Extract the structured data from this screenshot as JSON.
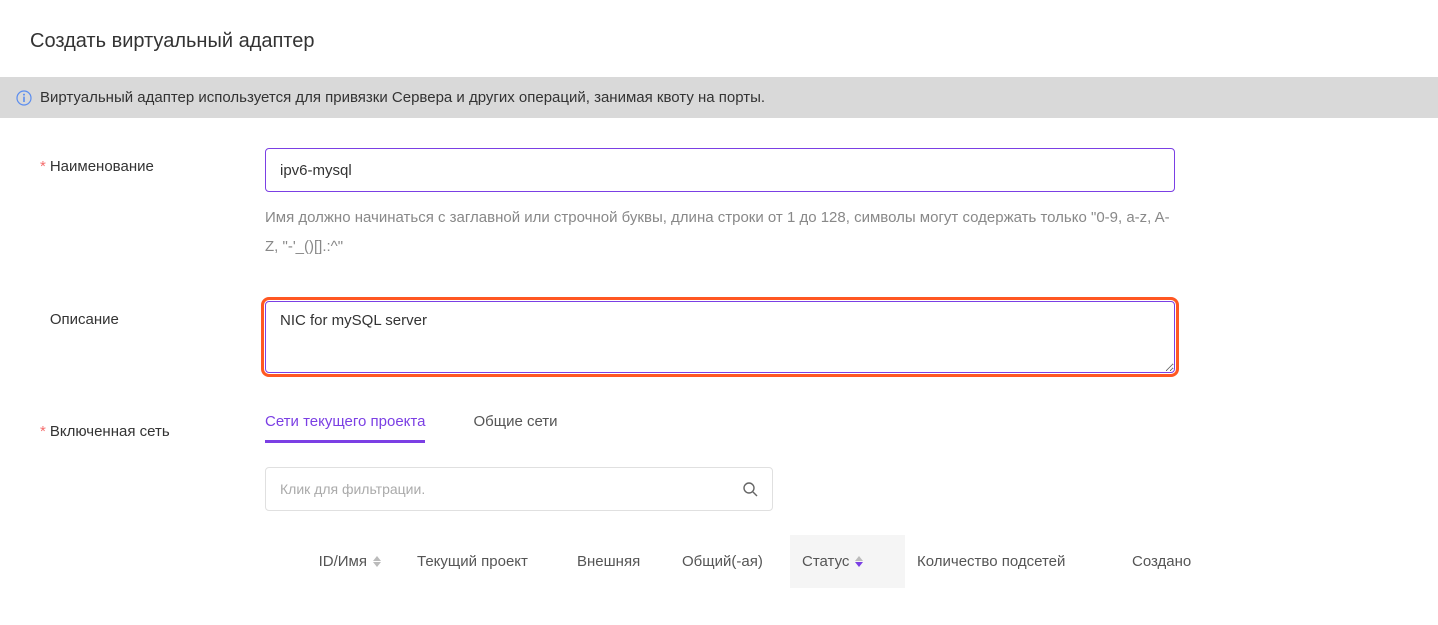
{
  "page": {
    "title": "Создать виртуальный адаптер",
    "info_text": "Виртуальный адаптер используется для привязки Сервера и других операций, занимая квоту на порты."
  },
  "form": {
    "name": {
      "label": "Наименование",
      "value": "ipv6-mysql",
      "help": "Имя должно начинаться с заглавной или строчной буквы, длина строки от 1 до 128, символы могут содержать только \"0-9, a-z, A-Z, \"-'_()[].:^\""
    },
    "description": {
      "label": "Описание",
      "value": "NIC for mySQL server"
    },
    "network": {
      "label": "Включенная сеть",
      "tabs": {
        "current": "Сети текущего проекта",
        "shared": "Общие сети"
      },
      "filter_placeholder": "Клик для фильтрации.",
      "columns": {
        "id": "ID/Имя",
        "project": "Текущий проект",
        "external": "Внешняя",
        "shared": "Общий(-ая)",
        "status": "Статус",
        "subnets": "Количество подсетей",
        "created": "Создано"
      }
    }
  }
}
